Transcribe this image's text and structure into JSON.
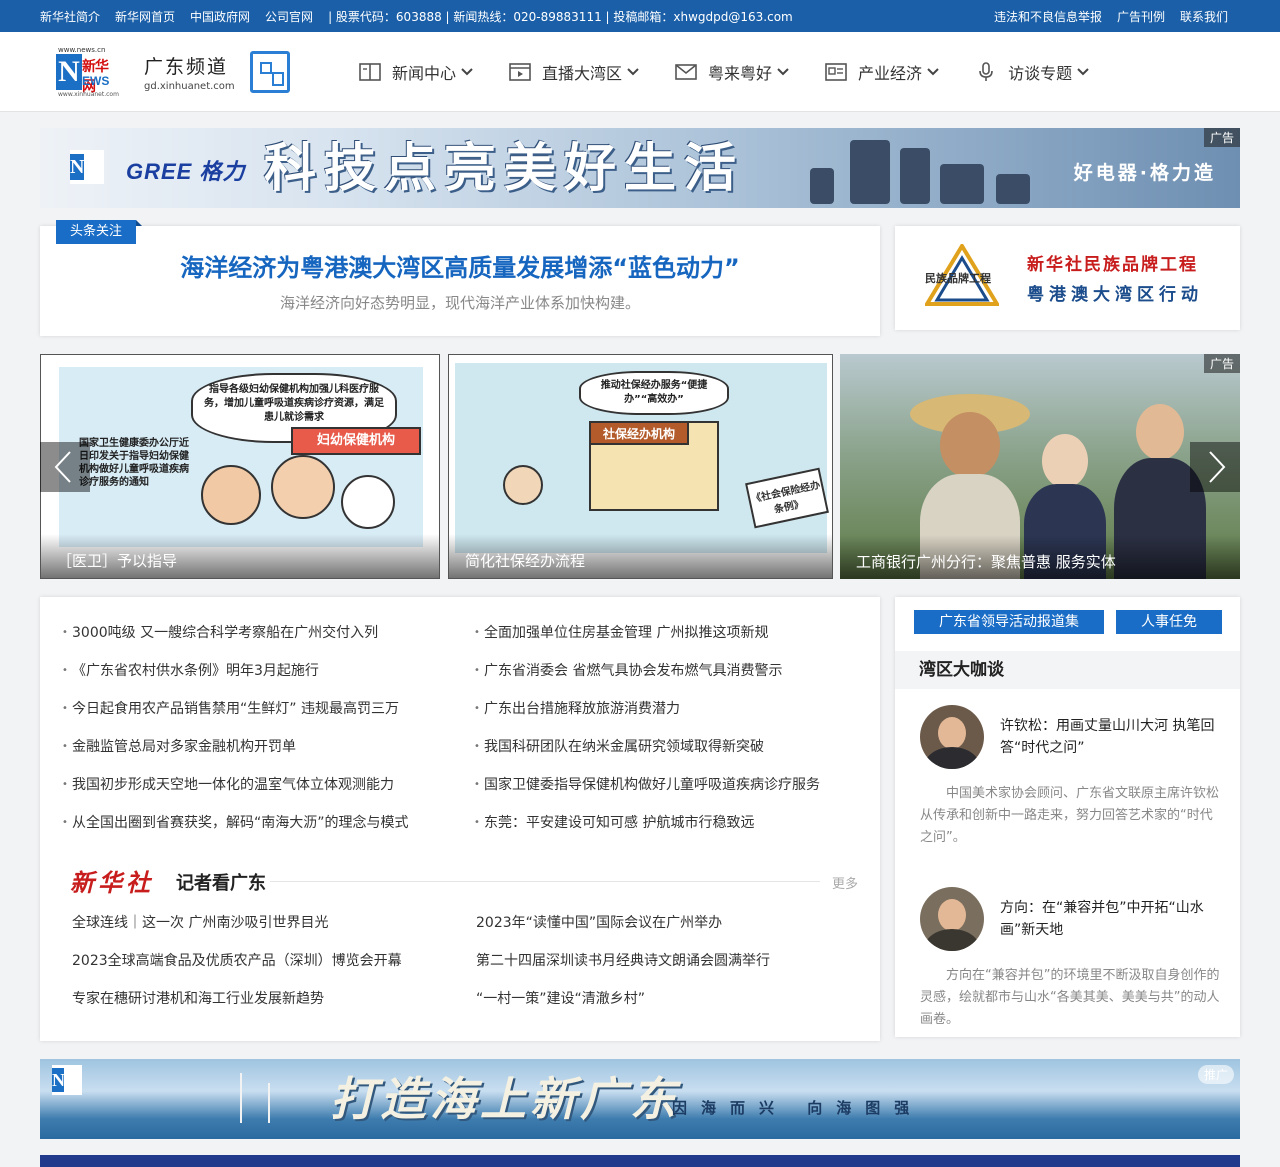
{
  "topbar": {
    "left": [
      "新华社简介",
      "新华网首页",
      "中国政府网",
      "公司官网",
      "| 股票代码：603888 | 新闻热线：020-89883111 | 投稿邮箱：xhwgdpd@163.com"
    ],
    "right": [
      "违法和不良信息举报",
      "广告刊例",
      "联系我们"
    ]
  },
  "header": {
    "logo_url": "www.news.cn",
    "logo_cn": "新华网",
    "logo_news": "EWS",
    "logo_url2": "www.xinhuanet.com",
    "channel_title": "广东频道",
    "channel_url": "gd.xinhuanet.com",
    "nav": [
      "新闻中心",
      "直播大湾区",
      "粤来粤好",
      "产业经济",
      "访谈专题"
    ]
  },
  "ad_top": {
    "tag": "广告",
    "brand": "GREE 格力",
    "slogan": "科技点亮美好生活",
    "slogan_right": "好电器·格力造"
  },
  "headline": {
    "tag": "头条关注",
    "title": "海洋经济为粤港澳大湾区高质量发展增添“蓝色动力”",
    "subtitle": "海洋经济向好态势明显，现代海洋产业体系加快构建。"
  },
  "brand_box": {
    "logo_text": "民族品牌工程",
    "line1": "新华社民族品牌工程",
    "line2": "粤港澳大湾区行动"
  },
  "slides": [
    {
      "caption": "［医卫］予以指导",
      "bubble": "指导各级妇幼保健机构加强儿科医疗服务，增加儿童呼吸道疾病诊疗资源，满足患儿就诊需求",
      "sign": "妇幼保健机构",
      "note": "国家卫生健康委办公厅近日印发关于指导妇幼保健机构做好儿童呼吸道疾病诊疗服务的通知"
    },
    {
      "caption": "简化社保经办流程",
      "bubble": "推动社保经办服务“便捷办”“高效办”",
      "sign": "社保经办机构",
      "note": "《社会保险经办条例》"
    },
    {
      "caption": "工商银行广州分行：聚焦普惠 服务实体",
      "tag": "广告"
    }
  ],
  "news": {
    "col1": [
      "3000吨级 又一艘综合科学考察船在广州交付入列",
      "《广东省农村供水条例》明年3月起施行",
      "今日起食用农产品销售禁用“生鲜灯” 违规最高罚三万",
      "金融监管总局对多家金融机构开罚单",
      "我国初步形成天空地一体化的温室气体立体观测能力",
      "从全国出圈到省赛获奖，解码“南海大沥”的理念与模式"
    ],
    "col2": [
      "全面加强单位住房基金管理 广州拟推这项新规",
      "广东省消委会 省燃气具协会发布燃气具消费警示",
      "广东出台措施释放旅游消费潜力",
      "我国科研团队在纳米金属研究领域取得新突破",
      "国家卫健委指导保健机构做好儿童呼吸道疾病诊疗服务",
      "东莞：平安建设可知可感 护航城市行稳致远"
    ],
    "section_logo": "新华社",
    "section_title": "记者看广东",
    "more": "更多",
    "sub1": [
      "全球连线｜这一次 广州南沙吸引世界目光",
      "2023全球高端食品及优质农产品（深圳）博览会开幕",
      "专家在穗研讨港机和海工行业发展新趋势"
    ],
    "sub2": [
      "2023年“读懂中国”国际会议在广州举办",
      "第二十四届深圳读书月经典诗文朗诵会圆满举行",
      "“一村一策”建设“清澈乡村”"
    ]
  },
  "side": {
    "btn1": "广东省领导活动报道集",
    "btn2": "人事任免",
    "title": "湾区大咖谈",
    "items": [
      {
        "title": "许钦松：用画丈量山川大河 执笔回答“时代之问”",
        "desc": "中国美术家协会顾问、广东省文联原主席许钦松从传承和创新中一路走来，努力回答艺术家的“时代之问”。"
      },
      {
        "title": "方向：在“兼容并包”中开拓“山水画”新天地",
        "desc": "方向在“兼容并包”的环境里不断汲取自身创作的灵感，绘就都市与山水“各美其美、美美与共”的动人画卷。"
      }
    ]
  },
  "ad_bottom": {
    "tag": "推广",
    "slogan": "打造海上新广东",
    "sub": "因海而兴 向海图强"
  },
  "colors": {
    "topbar": "#1a5fa8",
    "accent": "#1a6dc6",
    "headline": "#1666c0",
    "red": "#c81d1d"
  }
}
